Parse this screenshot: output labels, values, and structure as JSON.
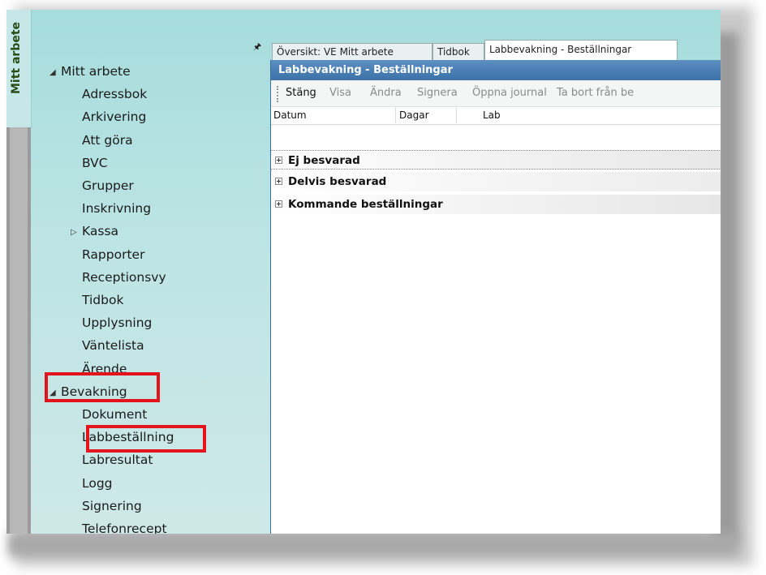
{
  "sidebar": {
    "vertical_tab": "Mitt arbete",
    "items": [
      {
        "label": "Mitt arbete",
        "level": 0,
        "arrow": "expanded"
      },
      {
        "label": "Adressbok",
        "level": 1
      },
      {
        "label": "Arkivering",
        "level": 1
      },
      {
        "label": "Att göra",
        "level": 1
      },
      {
        "label": "BVC",
        "level": 1
      },
      {
        "label": "Grupper",
        "level": 1
      },
      {
        "label": "Inskrivning",
        "level": 1
      },
      {
        "label": "Kassa",
        "level": 1,
        "arrow": "collapsed"
      },
      {
        "label": "Rapporter",
        "level": 1
      },
      {
        "label": "Receptionsvy",
        "level": 1
      },
      {
        "label": "Tidbok",
        "level": 1
      },
      {
        "label": "Upplysning",
        "level": 1
      },
      {
        "label": "Väntelista",
        "level": 1
      },
      {
        "label": "Ärende",
        "level": 1
      },
      {
        "label": "Bevakning",
        "level": 0,
        "arrow": "expanded",
        "highlighted": true
      },
      {
        "label": "Dokument",
        "level": 1
      },
      {
        "label": "Labbeställning",
        "level": 1,
        "highlighted": true
      },
      {
        "label": "Labresultat",
        "level": 1
      },
      {
        "label": "Logg",
        "level": 1
      },
      {
        "label": "Signering",
        "level": 1
      },
      {
        "label": "Telefonrecept",
        "level": 1
      }
    ],
    "highlight_color": "#e3141c"
  },
  "tabs": [
    {
      "label": "Översikt: VE Mitt arbete"
    },
    {
      "label": "Tidbok"
    },
    {
      "label": "Labbevakning - Beställningar",
      "active": true
    }
  ],
  "panel": {
    "title": "Labbevakning - Beställningar",
    "toolbar": [
      {
        "label": "Stäng",
        "enabled": true
      },
      {
        "label": "Visa",
        "enabled": false
      },
      {
        "label": "Ändra",
        "enabled": false
      },
      {
        "label": "Signera",
        "enabled": false
      },
      {
        "label": "Öppna journal",
        "enabled": false
      },
      {
        "label": "Ta bort från be",
        "enabled": false
      }
    ],
    "columns": [
      "Datum",
      "Dagar",
      "Lab"
    ],
    "groups": [
      "Ej besvarad",
      "Delvis besvarad",
      "Kommande beställningar"
    ]
  },
  "colors": {
    "nav_background": "#bde4e4",
    "panel_title_bar": "#4a7fb3"
  }
}
